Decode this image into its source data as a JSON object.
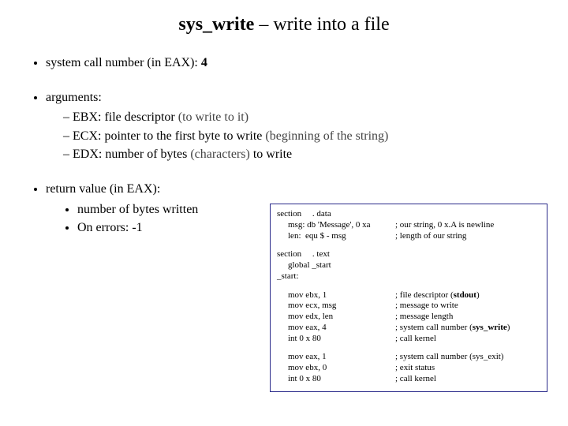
{
  "title": {
    "bold": "sys_write",
    "rest": " – write into a file"
  },
  "bullets": {
    "b1_pre": "system call number (in EAX): ",
    "b1_val": "4",
    "b2_head": "arguments:",
    "b2_items": {
      "i1_pre": "EBX: file descriptor ",
      "i1_paren": "(to write to it)",
      "i2_pre": "ECX: pointer to the first byte to write ",
      "i2_paren": "(beginning of the string)",
      "i3_pre": "EDX: number of bytes ",
      "i3_paren": "(characters)",
      "i3_post": " to write"
    },
    "b3_head": "return value (in EAX):",
    "b3_items": {
      "r1": "number of bytes written",
      "r2": "On errors: -1"
    }
  },
  "code": {
    "blk1": {
      "l1": "section     . data",
      "l2": "msg: db 'Message', 0 xa",
      "l2c": "; our string, 0 x.A is newline",
      "l3": "len:  equ $ - msg",
      "l3c": "; length of our string"
    },
    "blk2": {
      "l1": "section     . text",
      "l2": "global _start",
      "l3": "_start:"
    },
    "blk3": {
      "l1": "mov ebx, 1",
      "c1_a": "; file descriptor (",
      "c1_b": "stdout",
      "c1_c": ")",
      "l2": "mov ecx, msg",
      "c2": "; message to write",
      "l3": "mov edx, len",
      "c3": "; message length",
      "l4": "mov eax, 4",
      "c4_a": "; system call number (",
      "c4_b": "sys_write",
      "c4_c": ")",
      "l5": "int 0 x 80",
      "c5": "; call kernel"
    },
    "blk4": {
      "l1": "mov eax, 1",
      "c1": "; system call number (sys_exit)",
      "l2": "mov ebx, 0",
      "c2": "; exit status",
      "l3": "int 0 x 80",
      "c3": "; call kernel"
    }
  }
}
